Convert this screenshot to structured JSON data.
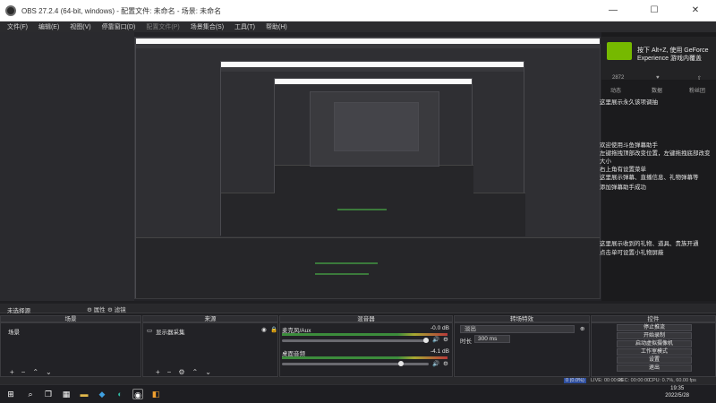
{
  "window": {
    "title": "OBS 27.2.4 (64-bit, windows) - 配置文件: 未命名 - 场景: 未命名",
    "min": "—",
    "max": "☐",
    "close": "✕"
  },
  "menu": [
    "文件(F)",
    "编辑(E)",
    "视图(V)",
    "停靠窗口(D)",
    "配置文件(P)",
    "场景集合(S)",
    "工具(T)",
    "帮助(H)"
  ],
  "menu_disabled_index": 4,
  "geforce": {
    "message": "按下 Alt+Z, 使用 GeForce Experience 游戏内覆盖",
    "brand_color": "#76b900"
  },
  "gf_stats": {
    "label1": "2872",
    "icon2": "♥",
    "icon3": "⇧",
    "tab1": "动态",
    "tab2": "数据",
    "tab3": "粉丝团"
  },
  "right_notes": {
    "n1": "这里展示永久该项调抽",
    "n2": "欢迎使用斗鱼弹幕助手",
    "n3": "左键拖拽顶部改变位置，左键拖拽底部改变大小",
    "n4": "右上角有设置菜单",
    "n5": "这里展示弹幕、直播信息、礼物弹幕等",
    "n6": "添加弹幕助手成功",
    "n7": "这里展示收到的礼物、道具、贵族开通",
    "n8": "点击单可设置小礼物屏蔽"
  },
  "scene_header": "未选择源",
  "dock_buttons": {
    "props": "属性",
    "filters": "滤镜"
  },
  "docks": {
    "scenes": {
      "title": "场景",
      "items": [
        "场景"
      ]
    },
    "sources": {
      "title": "来源",
      "items": [
        "显示器采集"
      ]
    },
    "mixer": {
      "title": "混音器",
      "ch1": {
        "name": "麦克风/Aux",
        "db": "-0.0 dB"
      },
      "ch2": {
        "name": "桌面音频",
        "db": "-4.1 dB"
      }
    },
    "transitions": {
      "title": "转场特效",
      "type": "淡出",
      "duration_label": "时长",
      "duration": "300 ms"
    },
    "controls": {
      "title": "控件",
      "buttons": [
        "停止推流",
        "开始录制",
        "启动虚拟摄像机",
        "工作室模式",
        "设置",
        "退出"
      ]
    }
  },
  "tools": {
    "add": "+",
    "remove": "−",
    "gear": "⚙",
    "up": "⌃",
    "down": "⌄"
  },
  "status": {
    "dropped": "0 (0.0%)",
    "live": "LIVE: 00:00:00",
    "rec": "REC: 00:00:00",
    "cpu": "CPU: 0.7%, 60.00 fps",
    "kbps": "kb/s: 12978"
  },
  "clock": {
    "time": "19:35",
    "date": "2022/5/28"
  }
}
